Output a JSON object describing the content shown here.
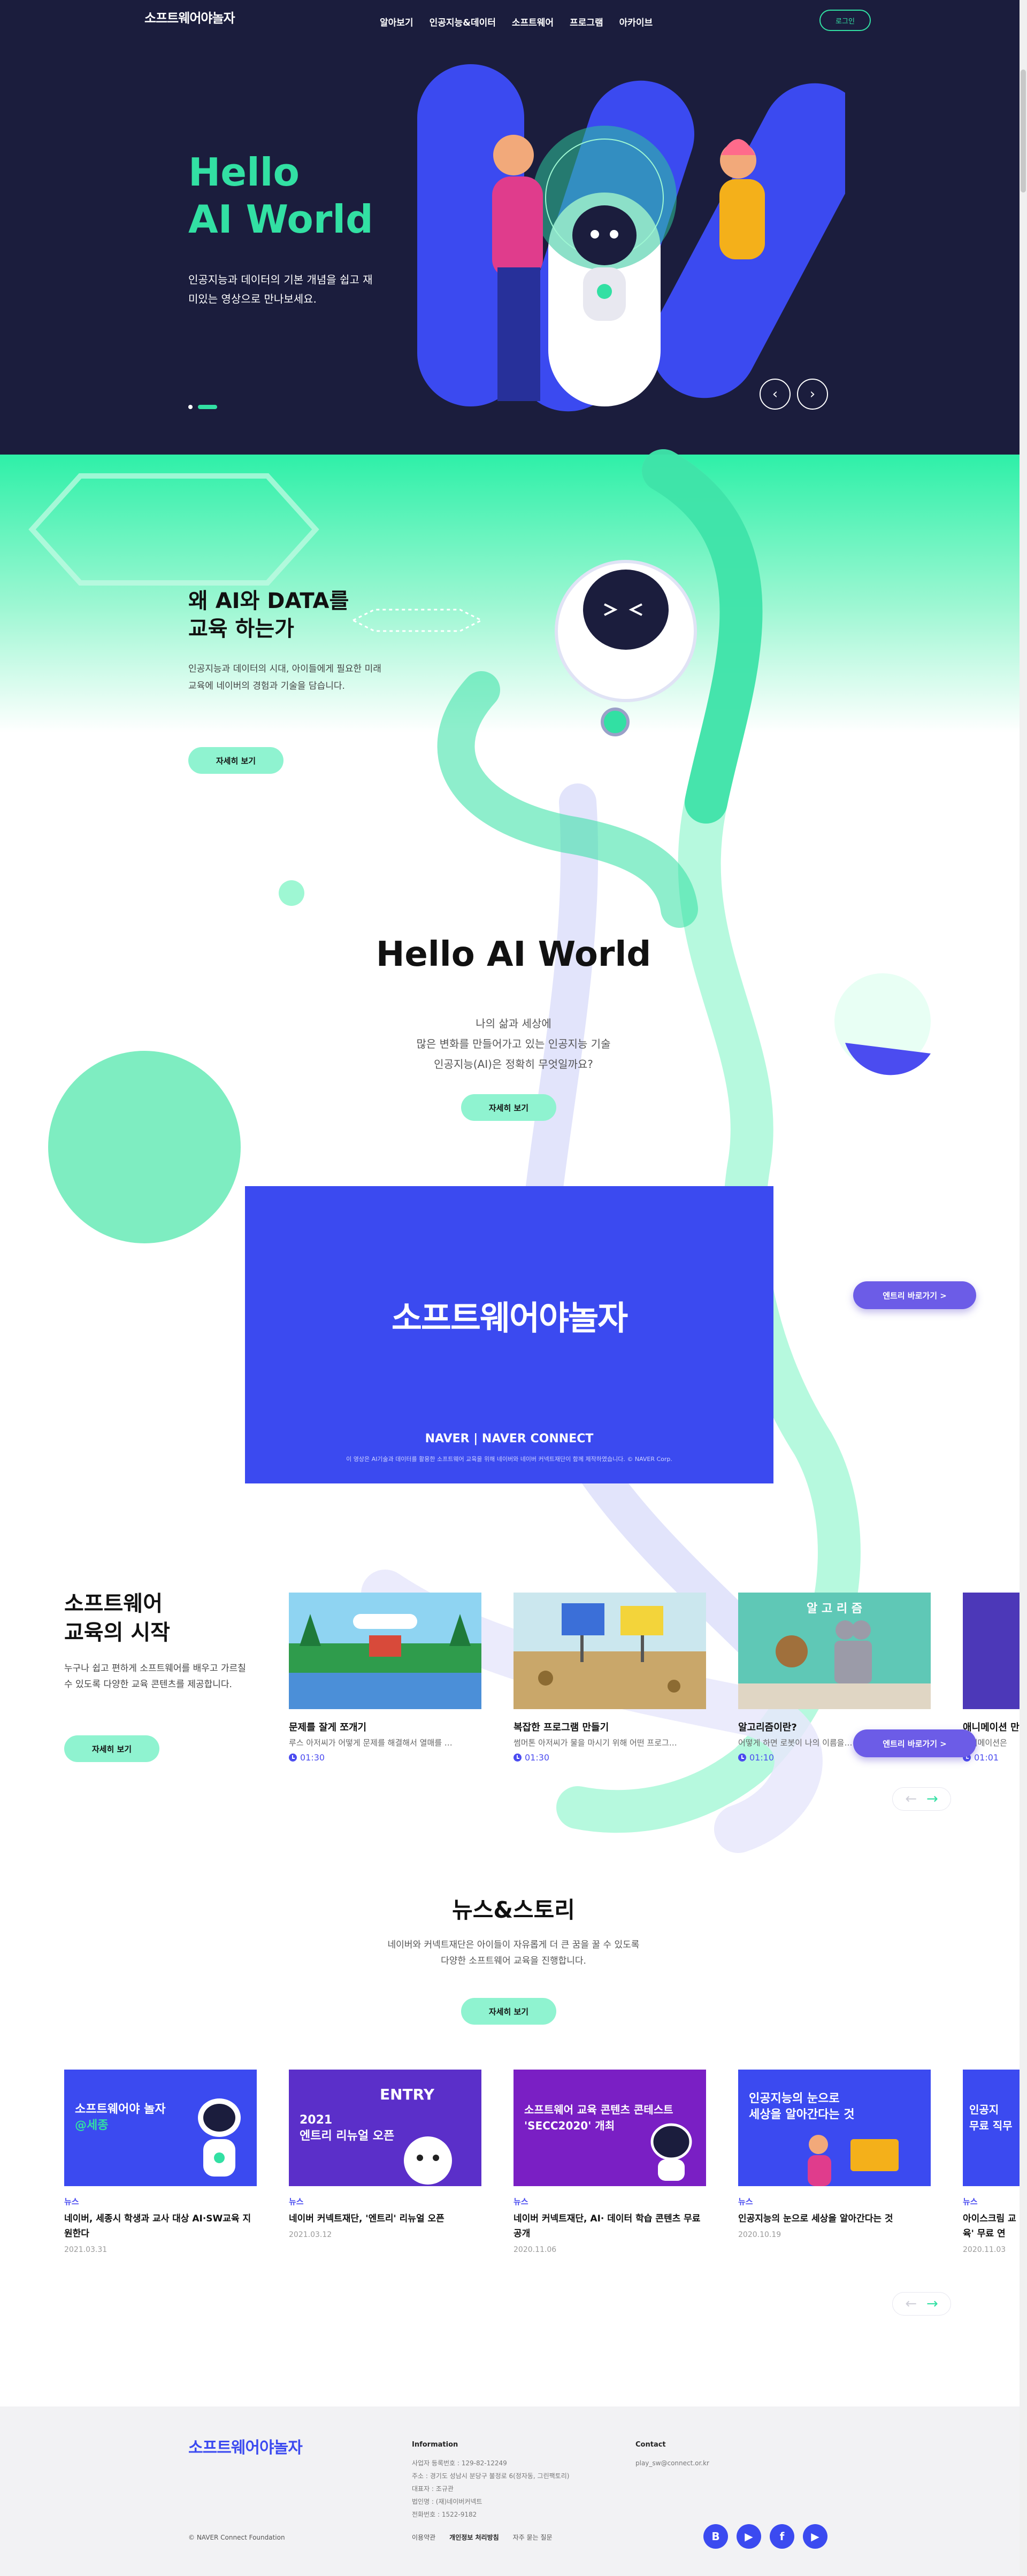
{
  "header": {
    "logo": "소프트웨어야놀자",
    "nav": [
      "알아보기",
      "인공지능&데이터",
      "소프트웨어",
      "프로그램",
      "아카이브"
    ],
    "login": "로그인"
  },
  "hero": {
    "title_line1": "Hello",
    "title_line2": "AI World",
    "sub": "인공지능과 데이터의 기본 개념을 쉽고 재미있는 영상으로 만나보세요.",
    "prev": "‹",
    "next": "›"
  },
  "why": {
    "title_line1": "왜 AI와 DATA를",
    "title_line2": "교육 하는가",
    "text": "인공지능과 데이터의 시대, 아이들에게 필요한 미래 교육에 네이버의 경험과 기술을 담습니다.",
    "button": "자세히 보기"
  },
  "hello": {
    "title": "Hello AI World",
    "text_line1": "나의 삶과 세상에",
    "text_line2": "많은 변화를 만들어가고 있는 인공지능 기술",
    "text_line3": "인공지능(AI)은 정확히 무엇일까요?",
    "button": "자세히 보기"
  },
  "banner": {
    "logo": "소프트웨어야놀자",
    "partners": "NAVER | NAVER CONNECT",
    "copy": "이 영상은 AI기술과 데이터를 활용한 소프트웨어 교육을 위해 네이버와 네이버 커넥트재단이 함께 제작하였습니다. © NAVER Corp.",
    "entry_button": "엔트리 바로가기 >"
  },
  "sw": {
    "title_line1": "소프트웨어",
    "title_line2": "교육의 시작",
    "text": "누구나 쉽고 편하게 소프트웨어를 배우고 가르칠 수 있도록 다양한 교육 콘텐츠를 제공합니다.",
    "button": "자세히 보기",
    "entry_button": "엔트리 바로가기 >",
    "cards": [
      {
        "title": "문제를 잘게 쪼개기",
        "desc": "루스 아저씨가 어떻게 문제를 해결해서 열매를 …",
        "time": "01:30"
      },
      {
        "title": "복잡한 프로그램 만들기",
        "desc": "썸머톤 아저씨가 물을 마시기 위해 어떤 프로그…",
        "time": "01:30"
      },
      {
        "title": "알고리즘이란?",
        "desc": "어떻게 하면 로봇이 나의 이름을…",
        "time": "01:10"
      },
      {
        "title": "애니메이션 만",
        "desc": "애니메이션은",
        "time": "01:01"
      }
    ],
    "thumb_text": "알 고 리 즘",
    "prev": "←",
    "next": "→"
  },
  "news": {
    "title": "뉴스&스토리",
    "text_line1": "네이버와 커넥트재단은 아이들이 자유롭게 더 큰 꿈을 꿀 수 있도록",
    "text_line2": "다양한 소프트웨어 교육을 진행합니다.",
    "button": "자세히 보기",
    "prev": "←",
    "next": "→",
    "items": [
      {
        "thumb_line1": "소프트웨어야 놀자",
        "thumb_line2": "@세종",
        "cat": "뉴스",
        "headline": "네이버, 세종시 학생과 교사 대상 AI·SW교육 지원한다",
        "date": "2021.03.31"
      },
      {
        "thumb_line1": "2021",
        "thumb_line2": "엔트리 리뉴얼 오픈",
        "cat": "뉴스",
        "headline": "네이버 커넥트재단, '엔트리' 리뉴얼 오픈",
        "date": "2021.03.12"
      },
      {
        "thumb_line1": "소프트웨어 교육 콘텐츠 콘테스트",
        "thumb_line2": "'SECC2020' 개최",
        "cat": "뉴스",
        "headline": "네이버 커넥트재단, AI· 데이터 학습 콘텐츠 무료 공개",
        "date": "2020.11.06"
      },
      {
        "thumb_line1": "인공지능의 눈으로",
        "thumb_line2": "세상을 알아간다는 것",
        "cat": "뉴스",
        "headline": "인공지능의 눈으로 세상을 알아간다는 것",
        "date": "2020.10.19"
      },
      {
        "thumb_line1": "인공지",
        "thumb_line2": "무료 직무",
        "cat": "뉴스",
        "headline": "아이스크림 교육' 무료 연",
        "date": "2020.11.03"
      }
    ],
    "entry_word": "ENTRY"
  },
  "footer": {
    "logo": "소프트웨어야놀자",
    "info_title": "Information",
    "info_lines": [
      "사업자 등록번호 : 129-82-12249",
      "주소 : 경기도 성남시 분당구 불정로 6(정자동, 그린팩토리)",
      "대표자 : 조규관",
      "법인명 : (재)네이버커넥트",
      "전화번호 : 1522-9182"
    ],
    "contact_title": "Contact",
    "contact_email": "play_sw@connect.or.kr",
    "copyright": "© NAVER Connect Foundation",
    "links": [
      "이용약관",
      "개인정보 처리방침",
      "자주 묻는 질문"
    ],
    "sns": [
      "B",
      "▶",
      "f",
      "▶"
    ]
  },
  "colors": {
    "navy": "#1b1d3d",
    "mint": "#32e0a3",
    "blue": "#3b4af0",
    "purple": "#6c5ce7"
  }
}
